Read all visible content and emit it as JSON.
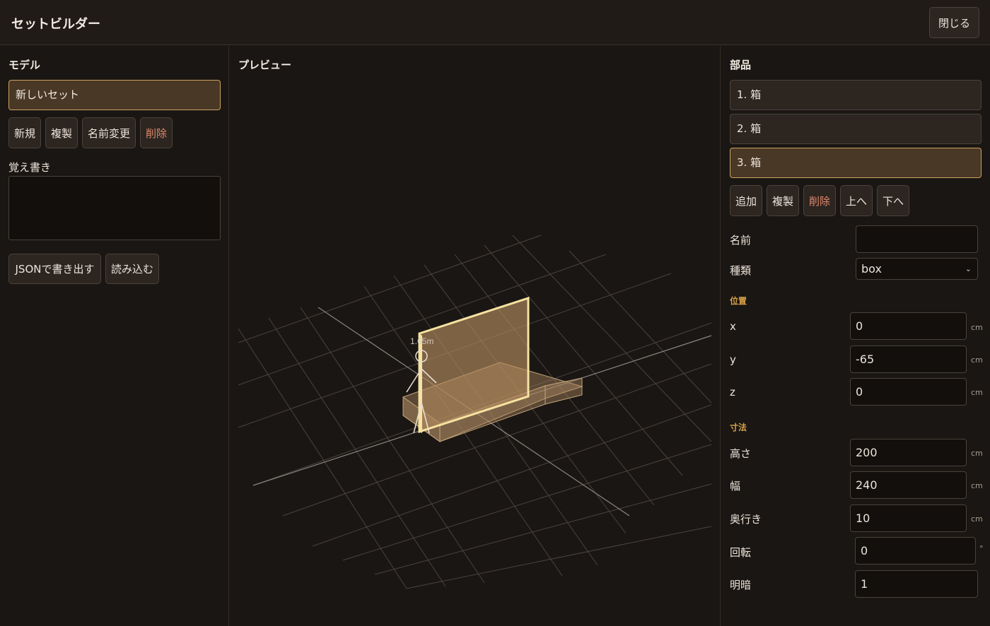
{
  "header": {
    "title": "セットビルダー",
    "close_label": "閉じる"
  },
  "model_panel": {
    "title": "モデル",
    "model_name": "新しいセット",
    "buttons": {
      "new": "新規",
      "duplicate": "複製",
      "rename": "名前変更",
      "delete": "削除"
    },
    "notes_label": "覚え書き",
    "notes_value": "",
    "export_label": "JSONで書き出す",
    "import_label": "読み込む"
  },
  "preview": {
    "title": "プレビュー",
    "figure_label": "1.65m"
  },
  "parts_panel": {
    "title": "部品",
    "items": [
      {
        "label": "1. 箱"
      },
      {
        "label": "2. 箱"
      },
      {
        "label": "3. 箱"
      }
    ],
    "selected_index": 2,
    "buttons": {
      "add": "追加",
      "duplicate": "複製",
      "delete": "削除",
      "up": "上へ",
      "down": "下へ"
    },
    "name_label": "名前",
    "name_value": "",
    "type_label": "種類",
    "type_value": "box",
    "position_title": "位置",
    "x_label": "x",
    "x_value": "0",
    "y_label": "y",
    "y_value": "-65",
    "z_label": "z",
    "z_value": "0",
    "dimensions_title": "寸法",
    "height_label": "高さ",
    "height_value": "200",
    "width_label": "幅",
    "width_value": "240",
    "depth_label": "奥行き",
    "depth_value": "10",
    "rotation_label": "回転",
    "rotation_value": "0",
    "brightness_label": "明暗",
    "brightness_value": "1",
    "unit_cm": "cm",
    "unit_deg": "°"
  },
  "colors": {
    "accent": "#c9a35f",
    "danger": "#e08a6d",
    "section": "#d8a24a"
  }
}
